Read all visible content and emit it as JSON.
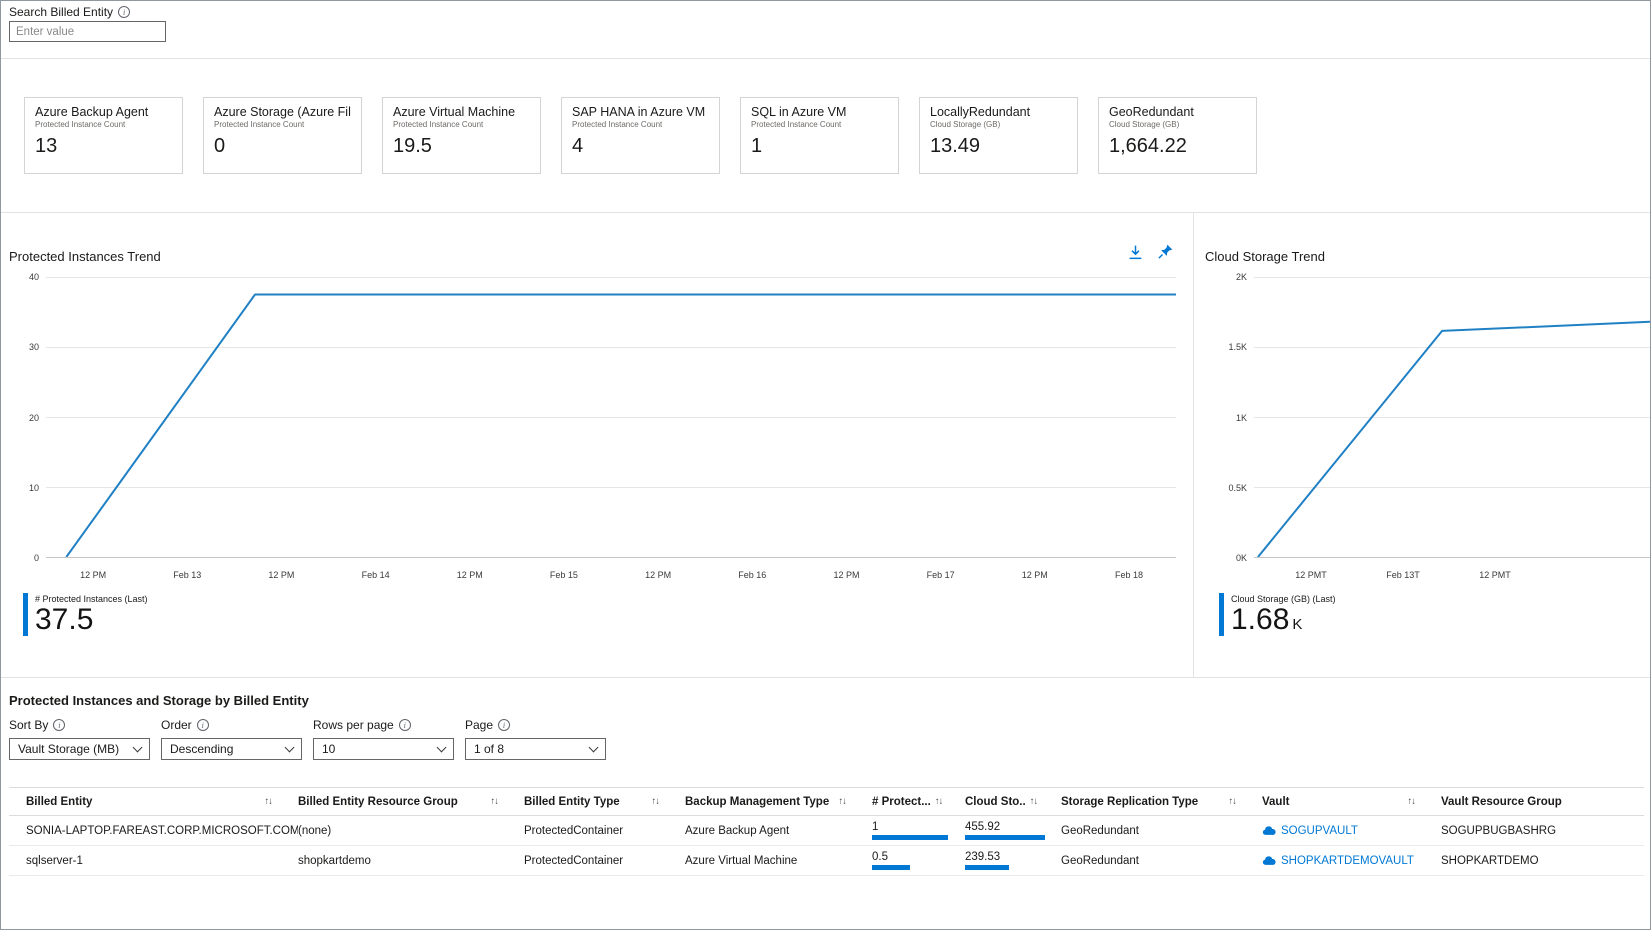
{
  "colors": {
    "accent": "#0078d4",
    "chart_line": "#2080c4"
  },
  "search": {
    "label": "Search Billed Entity",
    "placeholder": "Enter value"
  },
  "cards": [
    {
      "title": "Azure Backup Agent",
      "subtitle": "Protected Instance Count",
      "value": "13"
    },
    {
      "title": "Azure Storage (Azure Fil...",
      "subtitle": "Protected Instance Count",
      "value": "0"
    },
    {
      "title": "Azure Virtual Machine",
      "subtitle": "Protected Instance Count",
      "value": "19.5"
    },
    {
      "title": "SAP HANA in Azure VM",
      "subtitle": "Protected Instance Count",
      "value": "4"
    },
    {
      "title": "SQL in Azure VM",
      "subtitle": "Protected Instance Count",
      "value": "1"
    },
    {
      "title": "LocallyRedundant",
      "subtitle": "Cloud Storage (GB)",
      "value": "13.49"
    },
    {
      "title": "GeoRedundant",
      "subtitle": "Cloud Storage (GB)",
      "value": "1,664.22"
    }
  ],
  "chart_data": [
    {
      "type": "line",
      "title": "Protected Instances Trend",
      "ylim": [
        0,
        40
      ],
      "yticks": [
        "40",
        "30",
        "20",
        "10",
        "0"
      ],
      "xticks": [
        "12 PM",
        "Feb 13",
        "12 PM",
        "Feb 14",
        "12 PM",
        "Feb 15",
        "12 PM",
        "Feb 16",
        "12 PM",
        "Feb 17",
        "12 PM",
        "Feb 18"
      ],
      "series": [
        {
          "name": "# Protected Instances",
          "points": [
            [
              0.018,
              0
            ],
            [
              0.185,
              37.5
            ],
            [
              1,
              37.5
            ]
          ]
        }
      ],
      "legend": {
        "label": "# Protected Instances (Last)",
        "value": "37.5",
        "unit": ""
      },
      "grid": "horizontal",
      "legend_position": "bottom-left"
    },
    {
      "type": "line",
      "title": "Cloud Storage Trend",
      "ylim": [
        0,
        2000
      ],
      "yticks": [
        "2K",
        "1.5K",
        "1K",
        "0.5K",
        "0K"
      ],
      "xticks": [
        "12 PMT",
        "Feb 13T",
        "12 PMT"
      ],
      "series": [
        {
          "name": "Cloud Storage (GB)",
          "points": [
            [
              0.01,
              0
            ],
            [
              0.475,
              1615
            ],
            [
              1,
              1680
            ]
          ]
        }
      ],
      "legend": {
        "label": "Cloud Storage (GB) (Last)",
        "value": "1.68",
        "unit": "K"
      },
      "grid": "horizontal",
      "legend_position": "bottom-left"
    }
  ],
  "section": {
    "title": "Protected Instances and Storage by Billed Entity",
    "filters": [
      {
        "label": "Sort By",
        "value": "Vault Storage (MB)"
      },
      {
        "label": "Order",
        "value": "Descending"
      },
      {
        "label": "Rows per page",
        "value": "10"
      },
      {
        "label": "Page",
        "value": "1 of 8"
      }
    ]
  },
  "table": {
    "columns": [
      "Billed Entity",
      "Billed Entity Resource Group",
      "Billed Entity Type",
      "Backup Management Type",
      "# Protect...",
      "Cloud Sto..",
      "Storage Replication Type",
      "Vault",
      "Vault Resource Group"
    ],
    "rows": [
      {
        "billed_entity": "SONIA-LAPTOP.FAREAST.CORP.MICROSOFT.COM",
        "resource_group": "(none)",
        "entity_type": "ProtectedContainer",
        "backup_mgmt_type": "Azure Backup Agent",
        "protected_count": "1",
        "protected_bar": 0.95,
        "cloud_storage": "455.92",
        "cloud_bar": 1,
        "replication_type": "GeoRedundant",
        "vault": "SOGUPVAULT",
        "vault_resource_group": "SOGUPBUGBASHRG"
      },
      {
        "billed_entity": "sqlserver-1",
        "resource_group": "shopkartdemo",
        "entity_type": "ProtectedContainer",
        "backup_mgmt_type": "Azure Virtual Machine",
        "protected_count": "0.5",
        "protected_bar": 0.47,
        "cloud_storage": "239.53",
        "cloud_bar": 0.55,
        "replication_type": "GeoRedundant",
        "vault": "SHOPKARTDEMOVAULT",
        "vault_resource_group": "SHOPKARTDEMO"
      }
    ]
  }
}
